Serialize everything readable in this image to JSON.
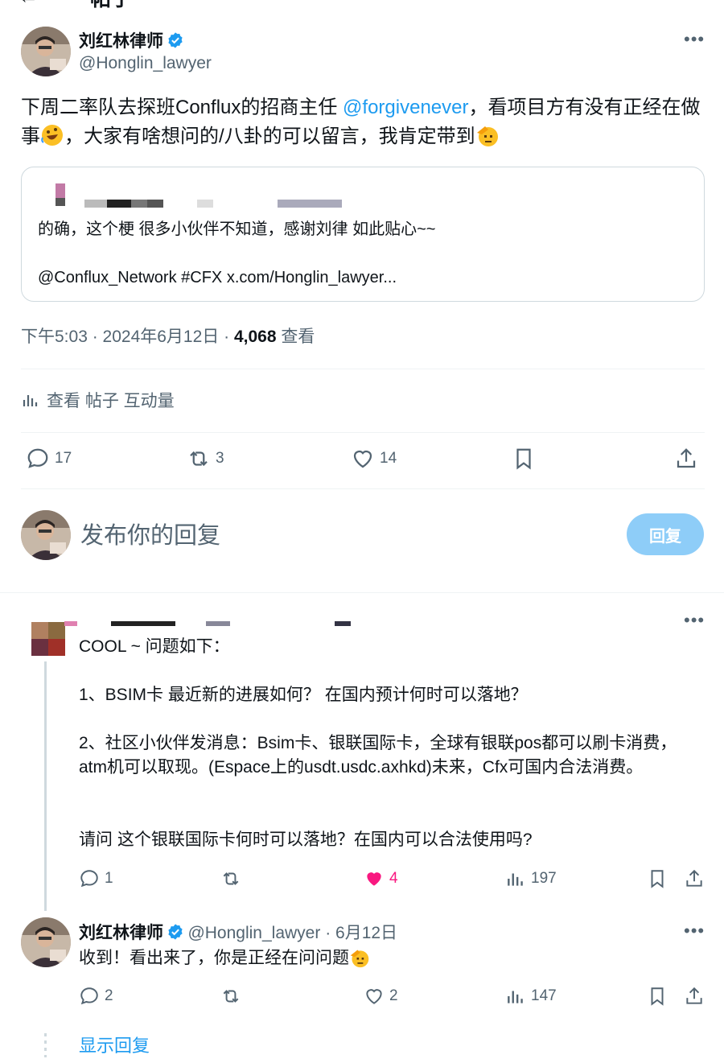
{
  "header": {
    "title": "帖子",
    "back_icon": "arrow-left-icon"
  },
  "post": {
    "author_name": "刘红林律师",
    "author_handle": "@Honglin_lawyer",
    "text_before": "下周二率队去探班Conflux的招商主任 ",
    "mention": "@forgivenever",
    "text_mid": "，看项目方有没有正经在做事",
    "text_mid2": "，大家有啥想问的/八卦的可以留言，我肯定带到",
    "quote": {
      "line1": "的确，这个梗 很多小伙伴不知道，感谢刘律 如此贴心~~",
      "line2": "@Conflux_Network #CFX x.com/Honglin_lawyer..."
    },
    "time": "下午5:03 · 2024年6月12日 · ",
    "views": "4,068",
    "views_label": " 查看",
    "engagement_label": "查看 帖子 互动量",
    "replies": "17",
    "reposts": "3",
    "likes": "14"
  },
  "composer": {
    "placeholder": "发布你的回复",
    "button": "回复"
  },
  "comment": {
    "line1": "COOL ~ 问题如下：",
    "line2": "1、BSIM卡 最近新的进展如何？ 在国内预计何时可以落地？",
    "line3": "2、社区小伙伴发消息：Bsim卡、银联国际卡，全球有银联pos都可以刷卡消费，atm机可以取现。(Espace上的usdt.usdc.axhkd)未来，Cfx可国内合法消费。",
    "line4": "请问 这个银联国际卡何时可以落地？在国内可以合法使用吗?",
    "replies": "1",
    "likes": "4",
    "views": "197"
  },
  "reply": {
    "author_name": "刘红林律师",
    "author_handle": "@Honglin_lawyer",
    "date": " · 6月12日",
    "text": "收到！看出来了，你是正经在问问题",
    "replies": "2",
    "likes": "2",
    "views": "147"
  },
  "show_replies": "显示回复",
  "colors": {
    "accent": "#1d9bf0",
    "like_active": "#f91880",
    "muted": "#536471"
  }
}
